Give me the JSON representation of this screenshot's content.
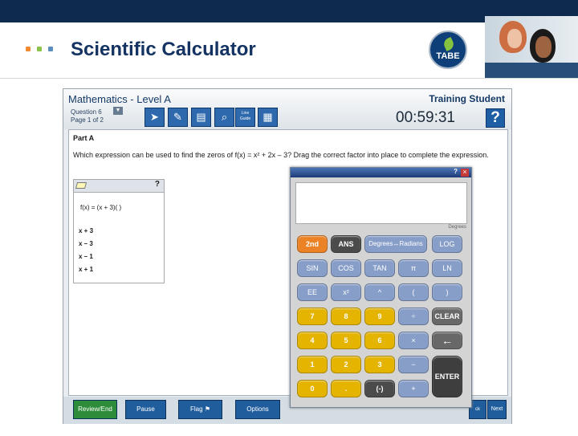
{
  "slide": {
    "title": "Scientific Calculator",
    "logo_text": "TABE",
    "accent_dots": [
      "#f08a30",
      "#8bc34a",
      "#5b8fbe"
    ]
  },
  "test": {
    "subject": "Mathematics - Level A",
    "student": "Training Student",
    "question_number": "Question 6",
    "page": "Page 1 of 2",
    "timer": "00:59:31",
    "help_label": "?",
    "tools": {
      "pointer": "arrow-pointer-icon",
      "pencil": "pencil-icon",
      "notepad": "notepad-icon",
      "magnifier": "magnifier-icon",
      "line_guide": "Line Guide",
      "calculator": "calculator-icon"
    },
    "part": "Part A",
    "prompt": "Which expression can be used to find the zeros of f(x) = x² + 2x – 3? Drag the correct factor into place to complete the expression.",
    "panel_help": "?",
    "equation": "f(x) = (x + 3)(        )",
    "factors": [
      "x + 3",
      "x – 3",
      "x – 1",
      "x + 1"
    ],
    "buttons": {
      "review": "Review/End Test",
      "pause": "Pause",
      "flag": "Flag",
      "options": "Options",
      "back": "ck",
      "next": "Next"
    }
  },
  "calculator": {
    "help": "?",
    "close": "×",
    "mode": "Degrees",
    "keys": [
      "2nd",
      "ANS",
      "Degrees↔Radians",
      "LOG",
      "SIN",
      "COS",
      "TAN",
      "π",
      "LN",
      "EE",
      "x²",
      "^",
      "(",
      ")",
      "7",
      "8",
      "9",
      "÷",
      "CLEAR",
      "4",
      "5",
      "6",
      "×",
      "←",
      "1",
      "2",
      "3",
      "−",
      "ENTER",
      "0",
      ".",
      "(-)",
      "+"
    ]
  }
}
